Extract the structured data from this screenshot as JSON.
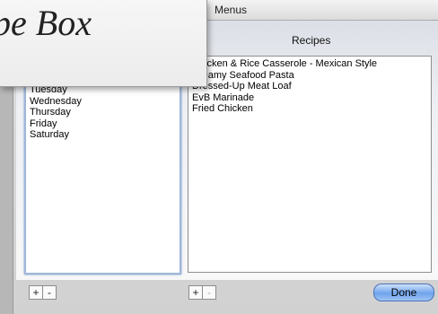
{
  "title_window": {
    "title": "pe Box"
  },
  "tab": {
    "label": "Menus"
  },
  "recipes_header": "Recipes",
  "days": [
    {
      "label": "Tuesday"
    },
    {
      "label": "Wednesday"
    },
    {
      "label": "Thursday"
    },
    {
      "label": "Friday"
    },
    {
      "label": "Saturday"
    }
  ],
  "recipes": [
    {
      "label": "Chicken & Rice Casserole - Mexican Style"
    },
    {
      "label": "Creamy Seafood Pasta"
    },
    {
      "label": "Dressed-Up Meat Loaf"
    },
    {
      "label": "EvB Marinade"
    },
    {
      "label": "Fried Chicken"
    }
  ],
  "buttons": {
    "add": "+",
    "remove": "-",
    "done": "Done"
  },
  "colors": {
    "done_button": "#6ea3ec",
    "focus_ring": "#9fb6d8"
  }
}
